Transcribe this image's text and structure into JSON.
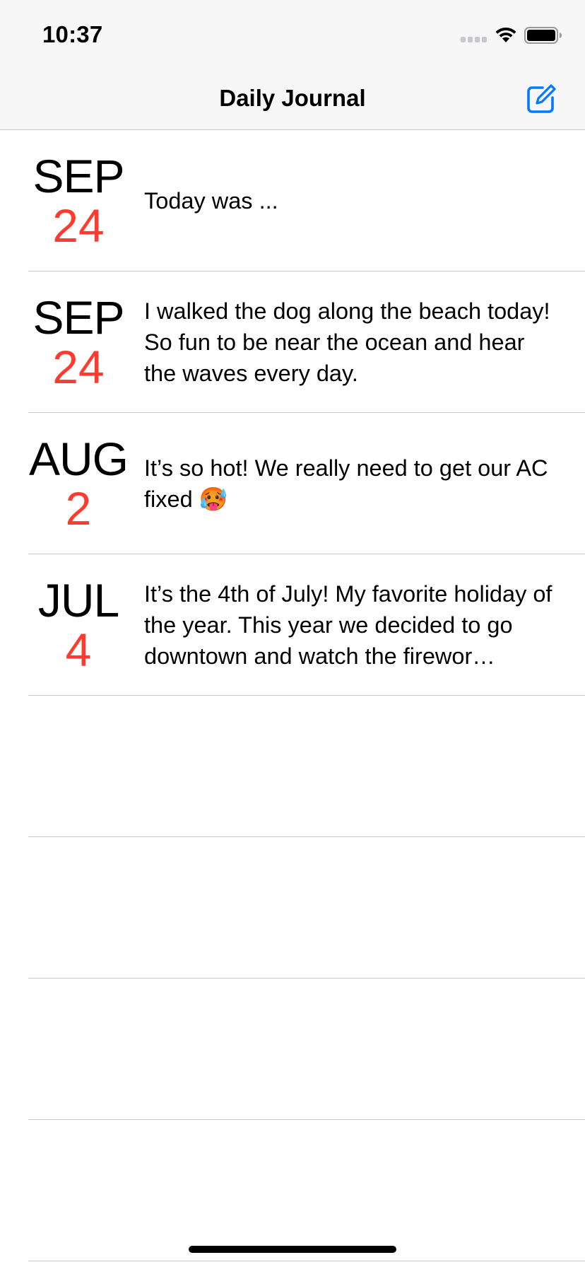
{
  "status_bar": {
    "time": "10:37"
  },
  "nav": {
    "title": "Daily Journal",
    "compose_icon": "compose-icon",
    "accent_color": "#007aff"
  },
  "entries": [
    {
      "month": "SEP",
      "day": "24",
      "text": "Today was ..."
    },
    {
      "month": "SEP",
      "day": "24",
      "text": "I walked the dog along the beach today! So fun to be near the ocean and hear the waves every day."
    },
    {
      "month": "AUG",
      "day": "2",
      "text": "It’s so hot! We really need to get our AC fixed 🥵"
    },
    {
      "month": "JUL",
      "day": "4",
      "text": "It’s the 4th of July! My favorite holiday of the year. This year we decided to go downtown and watch the firewor…"
    }
  ],
  "colors": {
    "day_number": "#ff3b30",
    "separator": "#c6c6c8",
    "chrome_background": "#f7f7f7"
  }
}
